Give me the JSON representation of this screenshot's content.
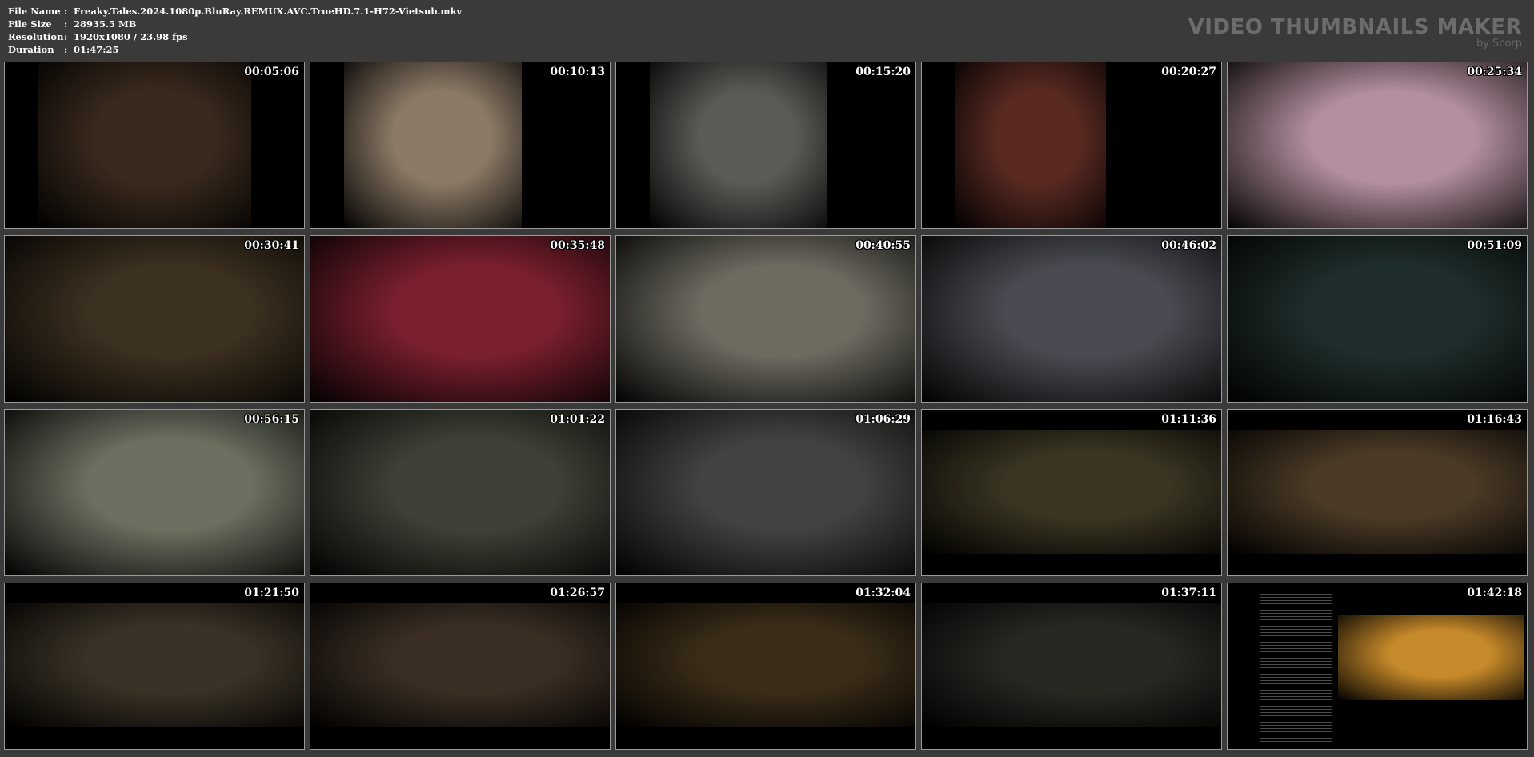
{
  "info": {
    "file_name_label": "File Name",
    "file_name": "Freaky.Tales.2024.1080p.BluRay.REMUX.AVC.TrueHD.7.1-H72-Vietsub.mkv",
    "file_size_label": "File Size",
    "file_size": "28935.5 MB",
    "resolution_label": "Resolution",
    "resolution": "1920x1080 / 23.98 fps",
    "duration_label": "Duration",
    "duration": "01:47:25",
    "separator": ":"
  },
  "brand": {
    "title": "VIDEO THUMBNAILS MAKER",
    "subtitle": "by Scorp"
  },
  "thumbnails": [
    {
      "time": "00:05:06",
      "color": "#3a2a1e"
    },
    {
      "time": "00:10:13",
      "color": "#8c7a66"
    },
    {
      "time": "00:15:20",
      "color": "#5a5a56"
    },
    {
      "time": "00:20:27",
      "color": "#5a2a22"
    },
    {
      "time": "00:25:34",
      "color": "#b48fa0"
    },
    {
      "time": "00:30:41",
      "color": "#3c3020"
    },
    {
      "time": "00:35:48",
      "color": "#7a1f2e"
    },
    {
      "time": "00:40:55",
      "color": "#6d6a60"
    },
    {
      "time": "00:46:02",
      "color": "#4a4a52"
    },
    {
      "time": "00:51:09",
      "color": "#1f2d2c"
    },
    {
      "time": "00:56:15",
      "color": "#6b7060"
    },
    {
      "time": "01:01:22",
      "color": "#3f4036"
    },
    {
      "time": "01:06:29",
      "color": "#424240"
    },
    {
      "time": "01:11:36",
      "color": "#3a3522"
    },
    {
      "time": "01:16:43",
      "color": "#4a3a26"
    },
    {
      "time": "01:21:50",
      "color": "#3a3226"
    },
    {
      "time": "01:26:57",
      "color": "#3a2e24"
    },
    {
      "time": "01:32:04",
      "color": "#3a2c18"
    },
    {
      "time": "01:37:11",
      "color": "#262822"
    },
    {
      "time": "01:42:18",
      "color": "#c78a2a"
    }
  ]
}
